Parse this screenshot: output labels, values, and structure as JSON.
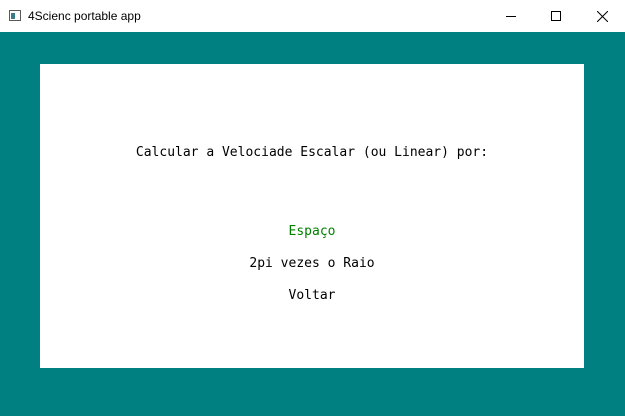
{
  "window": {
    "title": "4Scienc portable app",
    "icon": "app-window-icon",
    "controls": {
      "minimize_icon": "minimize-icon",
      "maximize_icon": "maximize-icon",
      "close_icon": "close-icon"
    }
  },
  "colors": {
    "background": "#008080",
    "panel": "#ffffff",
    "selected_option": "#008000",
    "text": "#000000"
  },
  "main": {
    "prompt": "Calcular a Velociade Escalar (ou Linear) por:",
    "options": [
      {
        "label": "Espaço",
        "selected": true
      },
      {
        "label": "2pi vezes o Raio",
        "selected": false
      },
      {
        "label": "Voltar",
        "selected": false
      }
    ]
  }
}
